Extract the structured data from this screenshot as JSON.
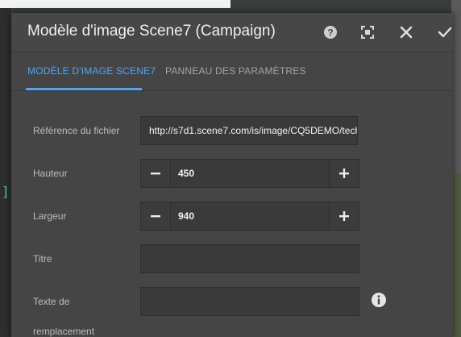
{
  "dialog": {
    "title": "Modèle d'image Scene7 (Campaign)",
    "icons": [
      "help-icon",
      "fullscreen-icon",
      "close-icon",
      "checkmark-icon"
    ]
  },
  "tabs": [
    {
      "label": "MODÈLE D'IMAGE SCENE7",
      "active": true
    },
    {
      "label": "PANNEAU DES PARAMÈTRES",
      "active": false
    }
  ],
  "form": {
    "reference": {
      "label": "Référence du fichier",
      "value": "http://s7d1.scene7.com/is/image/CQ5DEMO/tech"
    },
    "height": {
      "label": "Hauteur",
      "value": "450"
    },
    "width": {
      "label": "Largeur",
      "value": "940"
    },
    "title": {
      "label": "Titre",
      "value": ""
    },
    "alt_text": {
      "label": "Texte de remplacement",
      "line1": "Texte de",
      "line2": "remplacement",
      "value": ""
    }
  },
  "colors": {
    "accent": "#4ea6f5",
    "dialog_bg": "#454545",
    "field_bg": "#3a3a3a"
  }
}
